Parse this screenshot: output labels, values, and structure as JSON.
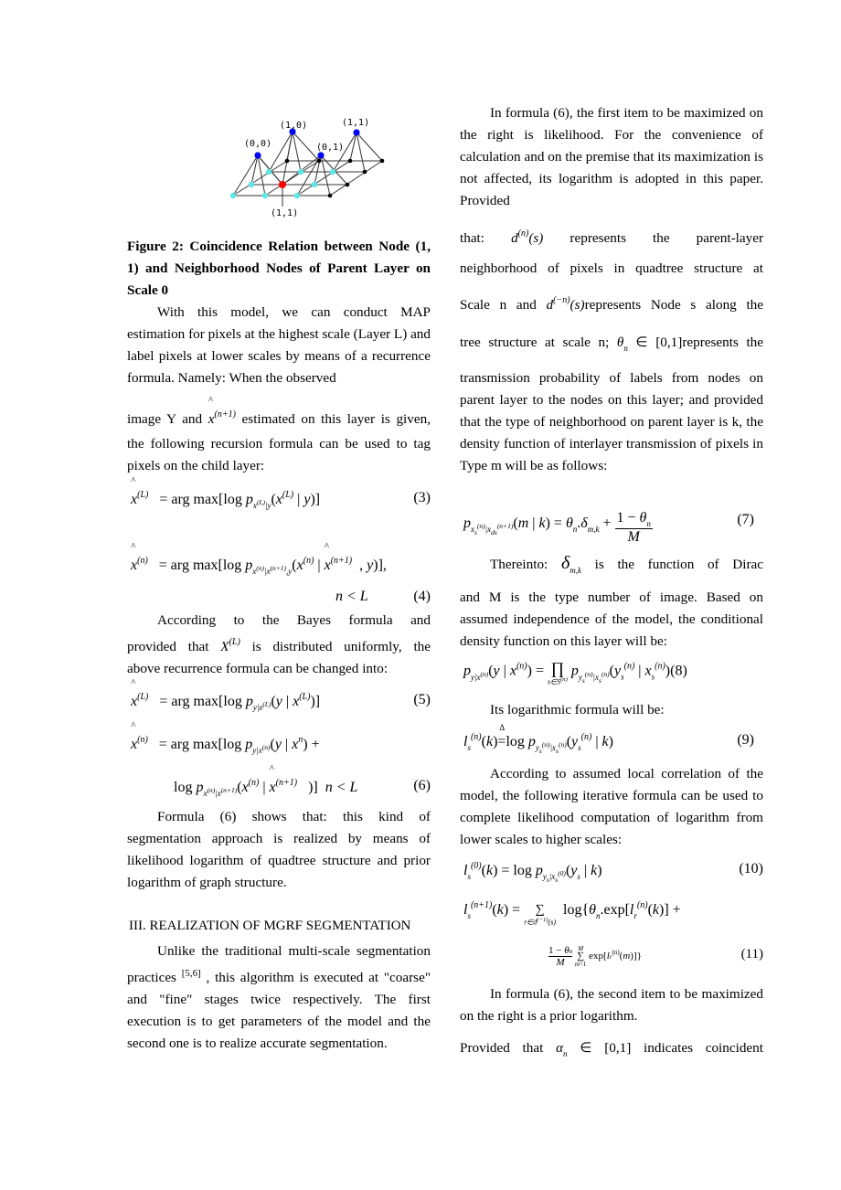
{
  "figure": {
    "labels": {
      "n00": "(0,0)",
      "n10": "(1,0)",
      "n01": "(0,1)",
      "n11_top": "(1,1)",
      "n11_bottom": "(1,1)"
    },
    "colors": {
      "parent_node": "#0000ff",
      "child_neighbor": "#5fe6e6",
      "target_node": "#ff0000",
      "other_node": "#000000",
      "edge": "#333333"
    },
    "caption": "Figure 2: Coincidence Relation between Node (1, 1) and Neighborhood Nodes of Parent Layer on Scale 0"
  },
  "left": {
    "para1": "With this model, we can conduct MAP estimation for pixels at the highest scale (Layer L) and label pixels at lower scales by means of a recurrence formula. Namely: When the observed",
    "para1b_pre": "image Y and",
    "para1b_post": "estimated on this layer is given,",
    "para1c": "the following recursion formula can be used to tag pixels on the child layer:",
    "eq3_num": "(3)",
    "eq4_num": "(4)",
    "eq4_cond": "n < L",
    "para2a": "According to the Bayes formula and",
    "para2b_pre": "provided that",
    "para2b_post": "is distributed uniformly, the",
    "para2c": "above recurrence formula can be changed into:",
    "eq5_num": "(5)",
    "eq6_num": "(6)",
    "eq6_cond": "n < L",
    "para3": "Formula (6) shows that: this kind of segmentation approach is realized by means of likelihood logarithm of quadtree structure and prior logarithm of graph structure.",
    "section_heading": "III.   REALIZATION OF MGRF SEGMENTATION",
    "para4_pre": "Unlike the traditional multi-scale segmentation practices",
    "para4_cite": "[5,6]",
    "para4_post": ", this algorithm is executed at \"coarse\" and \"fine\" stages twice respectively. The first execution is to get parameters of the model and the second one is to realize accurate segmentation."
  },
  "right": {
    "para1": "In formula (6), the first item to be maximized on the right is likelihood. For the convenience of calculation and on the premise that its maximization is not affected, its logarithm is adopted in this paper. Provided",
    "line_that": "that:",
    "line_that_post": "represents the parent-layer",
    "line_neigh": "neighborhood of pixels in quadtree structure at",
    "line_scale_pre": "Scale n and",
    "line_scale_post": "represents Node s along the",
    "line_tree_pre": "tree structure at scale n;",
    "line_tree_post": "represents the",
    "para2": "transmission probability of labels from nodes on parent layer to the nodes on this layer; and provided that the type of neighborhood on parent layer is k, the density function of interlayer transmission of pixels in Type m will be as follows:",
    "eq7_num": "(7)",
    "thereinto_pre": "Thereinto:",
    "thereinto_post": "is the function of Dirac",
    "para3": "and M is the type number of image. Based on assumed independence of the model, the conditional density function on this layer will be:",
    "eq8_num": "(8)",
    "para4": "Its logarithmic formula will be:",
    "eq9_num": "(9)",
    "para5": "According to assumed local correlation of the model, the following iterative formula can be used to complete likelihood computation of logarithm from lower scales to higher scales:",
    "eq10_num": "(10)",
    "eq11_num": "(11)",
    "para6": "In formula (6), the second item to be maximized on the right is a prior logarithm.",
    "last_pre": "Provided that",
    "last_post": "indicates coincident"
  }
}
